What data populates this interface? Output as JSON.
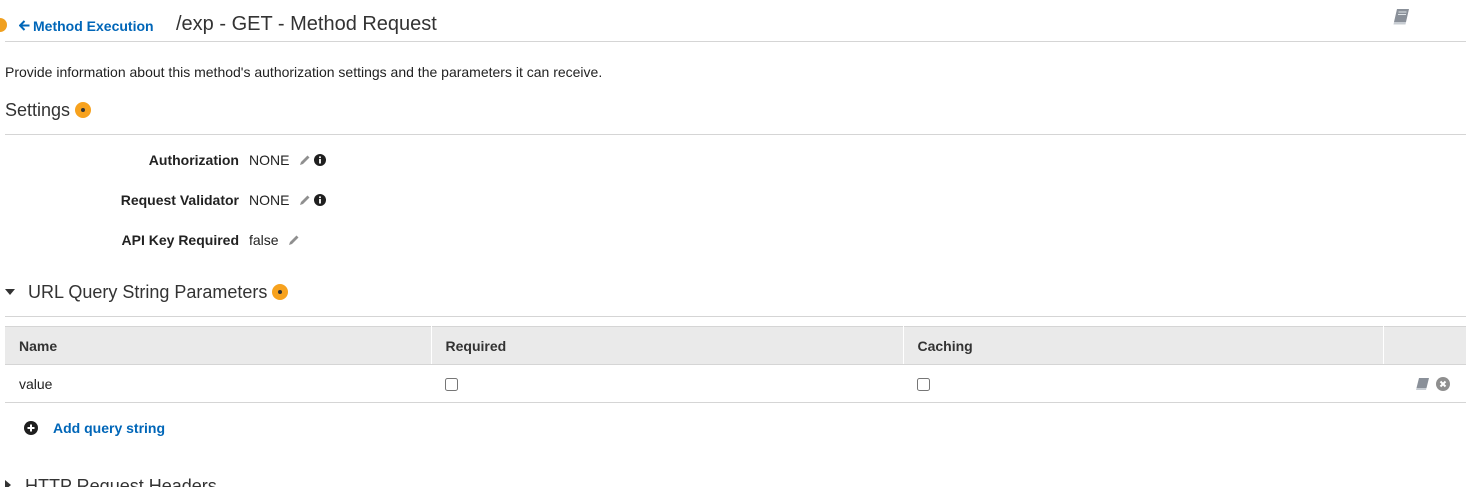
{
  "header": {
    "back_link": "Method Execution",
    "title": "/exp - GET - Method Request",
    "book_icon": "book-icon"
  },
  "description": "Provide information about this method's authorization settings and the parameters it can receive.",
  "settings": {
    "heading": "Settings",
    "rows": [
      {
        "label": "Authorization",
        "value": "NONE"
      },
      {
        "label": "Request Validator",
        "value": "NONE"
      },
      {
        "label": "API Key Required",
        "value": "false"
      }
    ]
  },
  "query_strings": {
    "heading": "URL Query String Parameters",
    "columns": [
      "Name",
      "Required",
      "Caching",
      ""
    ],
    "rows": [
      {
        "name": "value",
        "required": false,
        "caching": false
      }
    ],
    "add_label": "Add query string"
  },
  "headers_section": {
    "heading": "HTTP Request Headers"
  },
  "colors": {
    "link": "#0066b8",
    "accent": "#f7a21e",
    "table_header_bg": "#eaeaea",
    "rule": "#d5d5d5"
  }
}
